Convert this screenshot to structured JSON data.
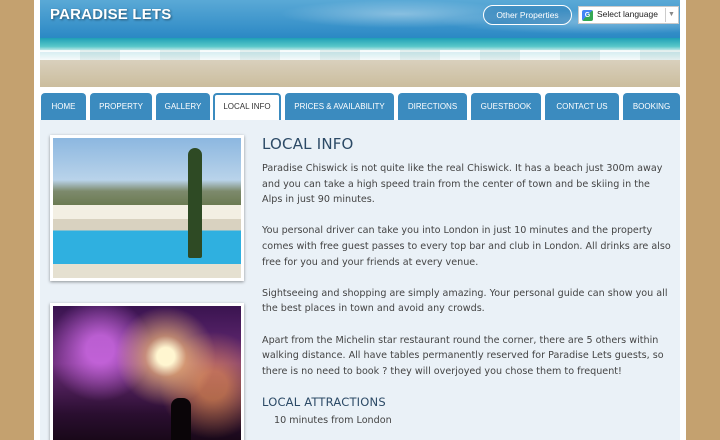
{
  "header": {
    "site_title": "PARADISE LETS",
    "other_properties_label": "Other Properties",
    "language_select": {
      "value": "Select language",
      "google_badge": "G"
    }
  },
  "nav": {
    "tabs": [
      {
        "label": "HOME"
      },
      {
        "label": "PROPERTY"
      },
      {
        "label": "GALLERY"
      },
      {
        "label": "LOCAL INFO",
        "active": true
      },
      {
        "label": "PRICES & AVAILABILITY"
      },
      {
        "label": "DIRECTIONS"
      },
      {
        "label": "GUESTBOOK"
      },
      {
        "label": "CONTACT US"
      },
      {
        "label": "BOOKING"
      }
    ]
  },
  "main": {
    "heading": "LOCAL INFO",
    "paragraphs": [
      "Paradise Chiswick is not quite like the real Chiswick. It has a beach just 300m away and you can take a high speed train from the center of town and be skiing in the Alps in just 90 minutes.",
      "You personal driver can take you into London in just 10 minutes and the property comes with free guest passes to every top bar and club in London. All drinks are also free for you and your friends at every venue.",
      "Sightseeing and shopping are simply amazing. Your personal guide can show you all the best places in town and avoid any crowds.",
      "Apart from the Michelin star restaurant round the corner, there are 5 others within walking distance. All have tables permanently reserved for Paradise Lets guests, so there is no need to book ? they will overjoyed you chose them to frequent!"
    ],
    "subheading": "LOCAL ATTRACTIONS",
    "attractions": [
      "10 minutes from London"
    ]
  },
  "colors": {
    "accent_blue": "#3b8bbf",
    "outer_background": "#c4a16f",
    "content_background": "#eaf1f7",
    "heading_color": "#2c4a66"
  },
  "images": {
    "photo1": "pool-villa-image",
    "photo2": "concert-stage-image"
  }
}
